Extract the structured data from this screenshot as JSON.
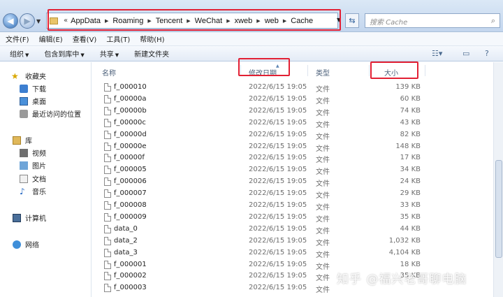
{
  "address": {
    "path": [
      "AppData",
      "Roaming",
      "Tencent",
      "WeChat",
      "xweb",
      "web",
      "Cache"
    ],
    "search_placeholder": "搜索 Cache"
  },
  "menu": [
    "文件(F)",
    "编辑(E)",
    "查看(V)",
    "工具(T)",
    "帮助(H)"
  ],
  "toolbar": {
    "organize": "组织",
    "include_library": "包含到库中",
    "share": "共享",
    "new_folder": "新建文件夹"
  },
  "sidebar": {
    "favorites": "收藏夹",
    "favorites_items": [
      "下载",
      "桌面",
      "最近访问的位置"
    ],
    "libraries": "库",
    "library_items": [
      "视频",
      "图片",
      "文档",
      "音乐"
    ],
    "computer": "计算机",
    "network": "网络"
  },
  "columns": {
    "name": "名称",
    "date": "修改日期",
    "type": "类型",
    "size": "大小"
  },
  "files": [
    {
      "name": "f_000010",
      "date": "2022/6/15 19:05",
      "type": "文件",
      "size": "139 KB"
    },
    {
      "name": "f_00000a",
      "date": "2022/6/15 19:05",
      "type": "文件",
      "size": "60 KB"
    },
    {
      "name": "f_00000b",
      "date": "2022/6/15 19:05",
      "type": "文件",
      "size": "74 KB"
    },
    {
      "name": "f_00000c",
      "date": "2022/6/15 19:05",
      "type": "文件",
      "size": "43 KB"
    },
    {
      "name": "f_00000d",
      "date": "2022/6/15 19:05",
      "type": "文件",
      "size": "82 KB"
    },
    {
      "name": "f_00000e",
      "date": "2022/6/15 19:05",
      "type": "文件",
      "size": "148 KB"
    },
    {
      "name": "f_00000f",
      "date": "2022/6/15 19:05",
      "type": "文件",
      "size": "17 KB"
    },
    {
      "name": "f_000005",
      "date": "2022/6/15 19:05",
      "type": "文件",
      "size": "34 KB"
    },
    {
      "name": "f_000006",
      "date": "2022/6/15 19:05",
      "type": "文件",
      "size": "24 KB"
    },
    {
      "name": "f_000007",
      "date": "2022/6/15 19:05",
      "type": "文件",
      "size": "29 KB"
    },
    {
      "name": "f_000008",
      "date": "2022/6/15 19:05",
      "type": "文件",
      "size": "33 KB"
    },
    {
      "name": "f_000009",
      "date": "2022/6/15 19:05",
      "type": "文件",
      "size": "35 KB"
    },
    {
      "name": "data_0",
      "date": "2022/6/15 19:05",
      "type": "文件",
      "size": "44 KB"
    },
    {
      "name": "data_2",
      "date": "2022/6/15 19:05",
      "type": "文件",
      "size": "1,032 KB"
    },
    {
      "name": "data_3",
      "date": "2022/6/15 19:05",
      "type": "文件",
      "size": "4,104 KB"
    },
    {
      "name": "f_000001",
      "date": "2022/6/15 19:05",
      "type": "文件",
      "size": "18 KB"
    },
    {
      "name": "f_000002",
      "date": "2022/6/15 19:05",
      "type": "文件",
      "size": "35 KB"
    },
    {
      "name": "f_000003",
      "date": "2022/6/15 19:05",
      "type": "文件",
      "size": ""
    }
  ],
  "watermark": "知乎 @福兴老哥聊电脑",
  "colors": {
    "highlight_box": "#e22034",
    "title_gradient_top": "#dbe8f6"
  }
}
